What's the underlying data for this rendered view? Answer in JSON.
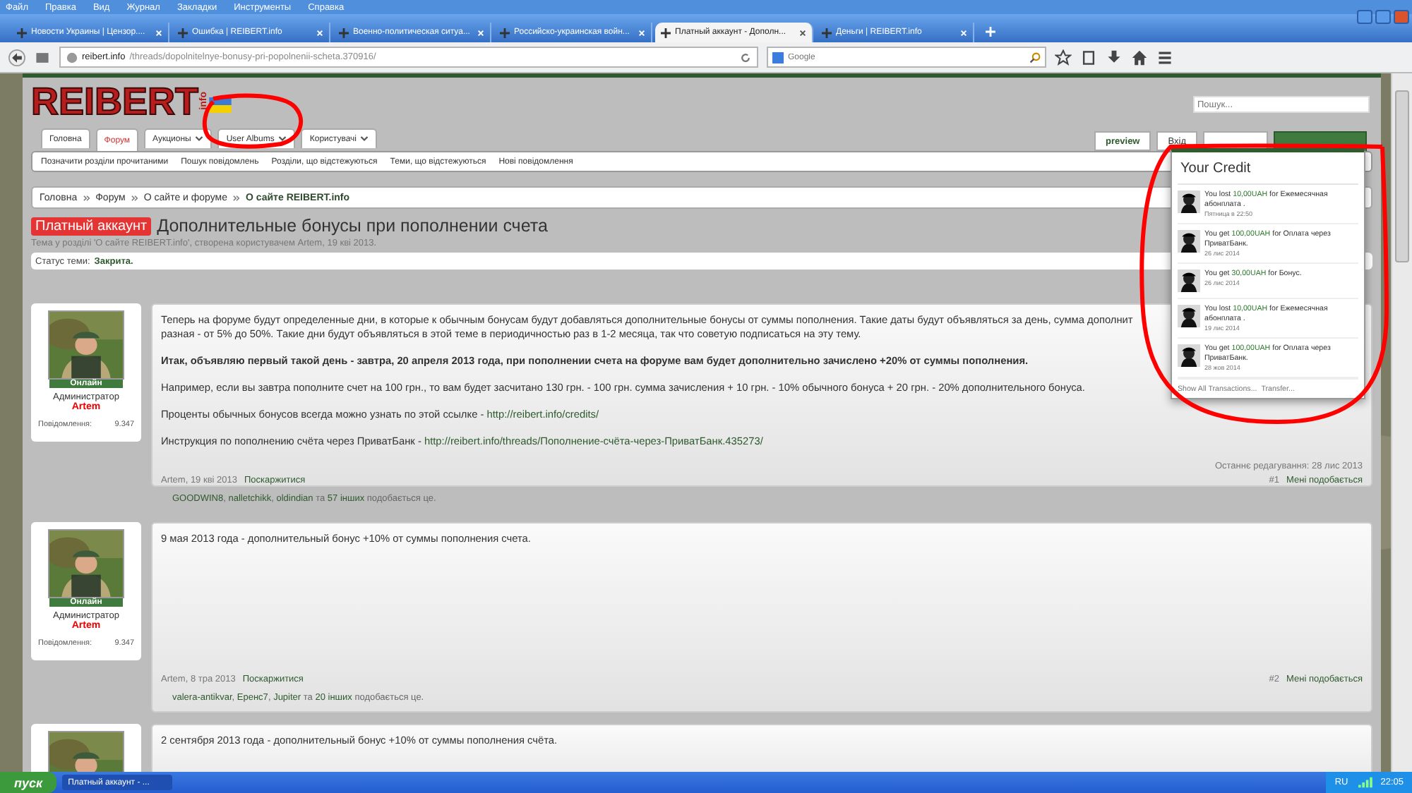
{
  "browser": {
    "menu": [
      "Файл",
      "Правка",
      "Вид",
      "Журнал",
      "Закладки",
      "Инструменты",
      "Справка"
    ],
    "tabs": [
      {
        "label": "Новости Украины | Цензор....",
        "selected": false
      },
      {
        "label": "Ошибка | REIBERT.info",
        "selected": false
      },
      {
        "label": "Военно-политическая ситуа...",
        "selected": false
      },
      {
        "label": "Российско-украинская войн...",
        "selected": false
      },
      {
        "label": "Платный аккаунт - Дополн...",
        "selected": true
      },
      {
        "label": "Деньги | REIBERT.info",
        "selected": false
      }
    ],
    "url_host": "reibert.info",
    "url_path": "/threads/dopolnitelnye-bonusy-pri-popolnenii-scheta.370916/",
    "search_placeholder": "Google"
  },
  "site": {
    "logo": "REIBERT",
    "logo_suffix": "info",
    "search_placeholder": "Пошук...",
    "header_buttons": [
      "preview",
      "Вхід"
    ],
    "nav_tabs": [
      {
        "label": "Головна",
        "selected": false,
        "dropdown": false
      },
      {
        "label": "Форум",
        "selected": true,
        "dropdown": false
      },
      {
        "label": "Аукционы",
        "selected": false,
        "dropdown": true
      },
      {
        "label": "User Albums",
        "selected": false,
        "dropdown": true
      },
      {
        "label": "Користувачі",
        "selected": false,
        "dropdown": true
      }
    ],
    "subnav": [
      "Позначити розділи прочитаними",
      "Пошук повідомлень",
      "Розділи, що відстежуються",
      "Теми, що відстежуються",
      "Нові повідомлення"
    ]
  },
  "breadcrumb": [
    "Головна",
    "Форум",
    "О сайте и форуме",
    "О сайте REIBERT.info"
  ],
  "thread": {
    "prefix": "Платный аккаунт",
    "title": "Дополнительные бонусы при пополнении счета",
    "meta": "Тема у розділі 'О сайте REIBERT.info', створена користувачем Artem, 19 кві 2013.",
    "status_label": "Статус теми:",
    "status": "Закрита."
  },
  "posts": [
    {
      "user": {
        "online": "Онлайн",
        "role": "Администратор",
        "name": "Artem",
        "stat_label": "Повідомлення:",
        "stat": "9.347"
      },
      "paragraphs": [
        {
          "kind": "text",
          "lines": [
            "Теперь на форуме будут определенные дни, в которые к обычным бонусам будут добавляться дополнительные бонусы от суммы пополнения. Такие даты будут объявляться за день, сумма дополнит",
            "разная - от 5% до 50%. Такие дни будут объявляться в этой теме в периодичностью раз в 1-2 месяца, так что советую подписаться на эту тему."
          ]
        },
        {
          "kind": "bold",
          "lines": [
            "Итак, объявляю первый такой день - завтра, 20 апреля 2013 года, при пополнении счета на форуме вам будет дополнительно зачислено +20% от суммы пополнения."
          ]
        },
        {
          "kind": "text",
          "lines": [
            "Например, если вы завтра пополните счет на 100 грн., то вам будет засчитано 130 грн. - 100 грн. сумма зачисления + 10 грн. - 10% обычного бонуса + 20 грн. - 20% дополнительного бонуса."
          ]
        },
        {
          "kind": "link",
          "text": "Проценты обычных бонусов всегда можно узнать по этой ссылке -",
          "link": "http://reibert.info/credits/"
        },
        {
          "kind": "link",
          "text": "Инструкция по пополнению счёта через ПриватБанк -",
          "link": "http://reibert.info/threads/Пополнение-счёта-через-ПриватБанк.435273/"
        }
      ],
      "edited": "Останнє редагування: 28 лис 2013",
      "author_date": "Artem, 19 кві 2013",
      "report": "Поскаржитися",
      "number": "#1",
      "like": "Мені подобається",
      "likes": "**GOODWIN8**, **nalletchikk**, **oldindian** та **57 інших** подобається це."
    },
    {
      "user": {
        "online": "Онлайн",
        "role": "Администратор",
        "name": "Artem",
        "stat_label": "Повідомлення:",
        "stat": "9.347"
      },
      "paragraphs": [
        {
          "kind": "text",
          "lines": [
            "9 мая 2013 года - дополнительный бонус +10% от суммы пополнения счета."
          ]
        }
      ],
      "author_date": "Artem, 8 тра 2013",
      "report": "Поскаржитися",
      "number": "#2",
      "like": "Мені подобається",
      "likes": "**valera-antikvar**, **Еренс7**, **Jupiter** та **20 інших** подобається це."
    },
    {
      "paragraphs": [
        {
          "kind": "text",
          "lines": [
            "2 сентября 2013 года - дополнительный бонус +10% от суммы пополнения счёта."
          ]
        }
      ]
    }
  ],
  "credit_popup": {
    "title": "Your Credit",
    "items": [
      {
        "text": "You lost **10,00UAH** for Ежемесячная абонплата .",
        "date": "Пятница в 22:50"
      },
      {
        "text": "You get **100,00UAH** for Оплата через ПриватБанк.",
        "date": "26 лис 2014"
      },
      {
        "text": "You get **30,00UAH** for Бонус.",
        "date": "26 лис 2014"
      },
      {
        "text": "You lost **10,00UAH** for Ежемесячная абонплата .",
        "date": "19 лис 2014"
      },
      {
        "text": "You get **100,00UAH** for Оплата через ПриватБанк.",
        "date": "28 жов 2014"
      }
    ],
    "links": [
      "Show All Transactions...",
      "Transfer..."
    ]
  },
  "taskbar": {
    "start": "пуск",
    "window": "Платный аккаунт - ...",
    "lang": "RU",
    "clock": "22:05"
  }
}
